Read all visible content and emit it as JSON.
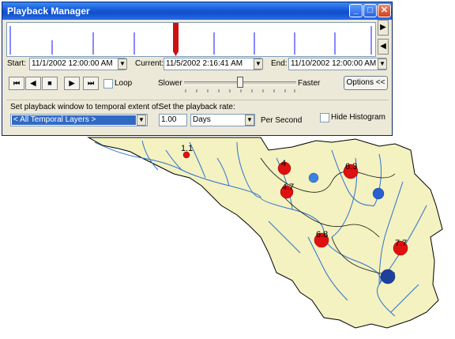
{
  "window": {
    "title": "Playback Manager",
    "minimize_icon": "minimize-icon",
    "maximize_icon": "maximize-icon",
    "close_icon": "close-icon"
  },
  "time_window": {
    "start_label": "Start:",
    "start_value": "11/1/2002 12:00:00 AM",
    "current_label": "Current:",
    "current_value": "11/5/2002 2:16:41 AM",
    "end_label": "End:",
    "end_value": "11/10/2002 12:00:00 AM"
  },
  "playback": {
    "loop_label": "Loop",
    "slower_label": "Slower",
    "faster_label": "Faster",
    "options_label": "Options <<",
    "speed_fraction": 0.5
  },
  "settings": {
    "extent_label": "Set playback window to temporal extent of:",
    "extent_value": "< All Temporal Layers >",
    "rate_label": "Set the playback rate:",
    "rate_value": "1.00",
    "unit_value": "Days",
    "per_second_label": "Per Second",
    "hide_histogram_label": "Hide Histogram"
  },
  "map": {
    "labels": [
      "1.1",
      "4",
      "4.7",
      "6.3",
      "6.8",
      "7.7"
    ],
    "colors": {
      "land": "#f3f2c0",
      "river": "#2f6fd0",
      "red_point": "#e01010",
      "blue_point": "#2a5fcf"
    }
  }
}
